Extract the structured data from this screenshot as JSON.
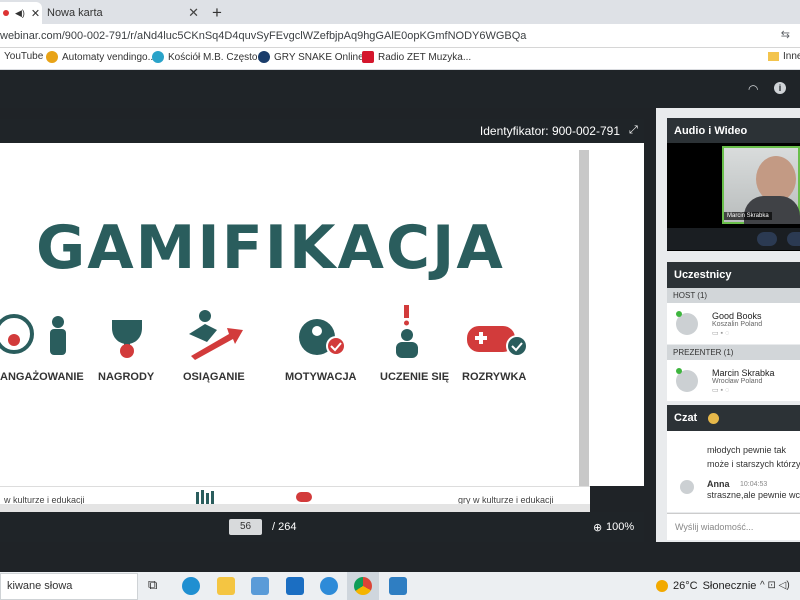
{
  "browser": {
    "tabs": [
      {
        "label": ""
      },
      {
        "label": "Nowa karta"
      }
    ],
    "new_tab": "+",
    "url": "webinar.com/900-002-791/r/aNd4luc5CKnSq4D4quvSyFEvgclWZefbjpAq9hgGAlE0opKGmfNODY6WGBQa",
    "bookmarks": [
      {
        "label": "YouTube"
      },
      {
        "label": "Automaty vendingo..."
      },
      {
        "label": "Kościół M.B. Często..."
      },
      {
        "label": "GRY SNAKE Online..."
      },
      {
        "label": "Radio ZET Muzyka..."
      },
      {
        "label": "Inne"
      }
    ]
  },
  "presentation": {
    "identifier": "Identyfikator: 900-002-791",
    "slide_title": "GAMIFIKACJA",
    "items": [
      {
        "label": "ANGAŻOWANIE"
      },
      {
        "label": "NAGRODY"
      },
      {
        "label": "OSIĄGANIE"
      },
      {
        "label": "MOTYWACJA"
      },
      {
        "label": "UCZENIE SIĘ"
      },
      {
        "label": "ROZRYWKA"
      }
    ],
    "footer_left": "w kulturze i edukacji",
    "footer_right": "gry w kulturze i edukacji",
    "page": "56",
    "page_total": "/ 264",
    "zoom": "100%"
  },
  "panel": {
    "audio_video_title": "Audio i Wideo",
    "camera_name": "Marcin Skrabka",
    "participants_title": "Uczestnicy",
    "host_label": "HOST (1)",
    "presenter_label": "PREZENTER (1)",
    "participants": [
      {
        "name": "Good Books",
        "location": "Koszalin Poland"
      },
      {
        "name": "Marcin Skrabka",
        "location": "Wrocław Poland"
      }
    ],
    "chat_title": "Czat",
    "chat_lines": [
      "młodych pewnie tak",
      "może i starszych którzy lu"
    ],
    "chat_msg": {
      "author": "Anna",
      "time": "10:04:53",
      "text": "straszne,ale pewnie wciąg"
    },
    "chat_placeholder": "Wyślij wiadomość..."
  },
  "taskbar": {
    "search_text": "kiwane słowa",
    "temperature": "26°C",
    "weather": "Słonecznie"
  }
}
